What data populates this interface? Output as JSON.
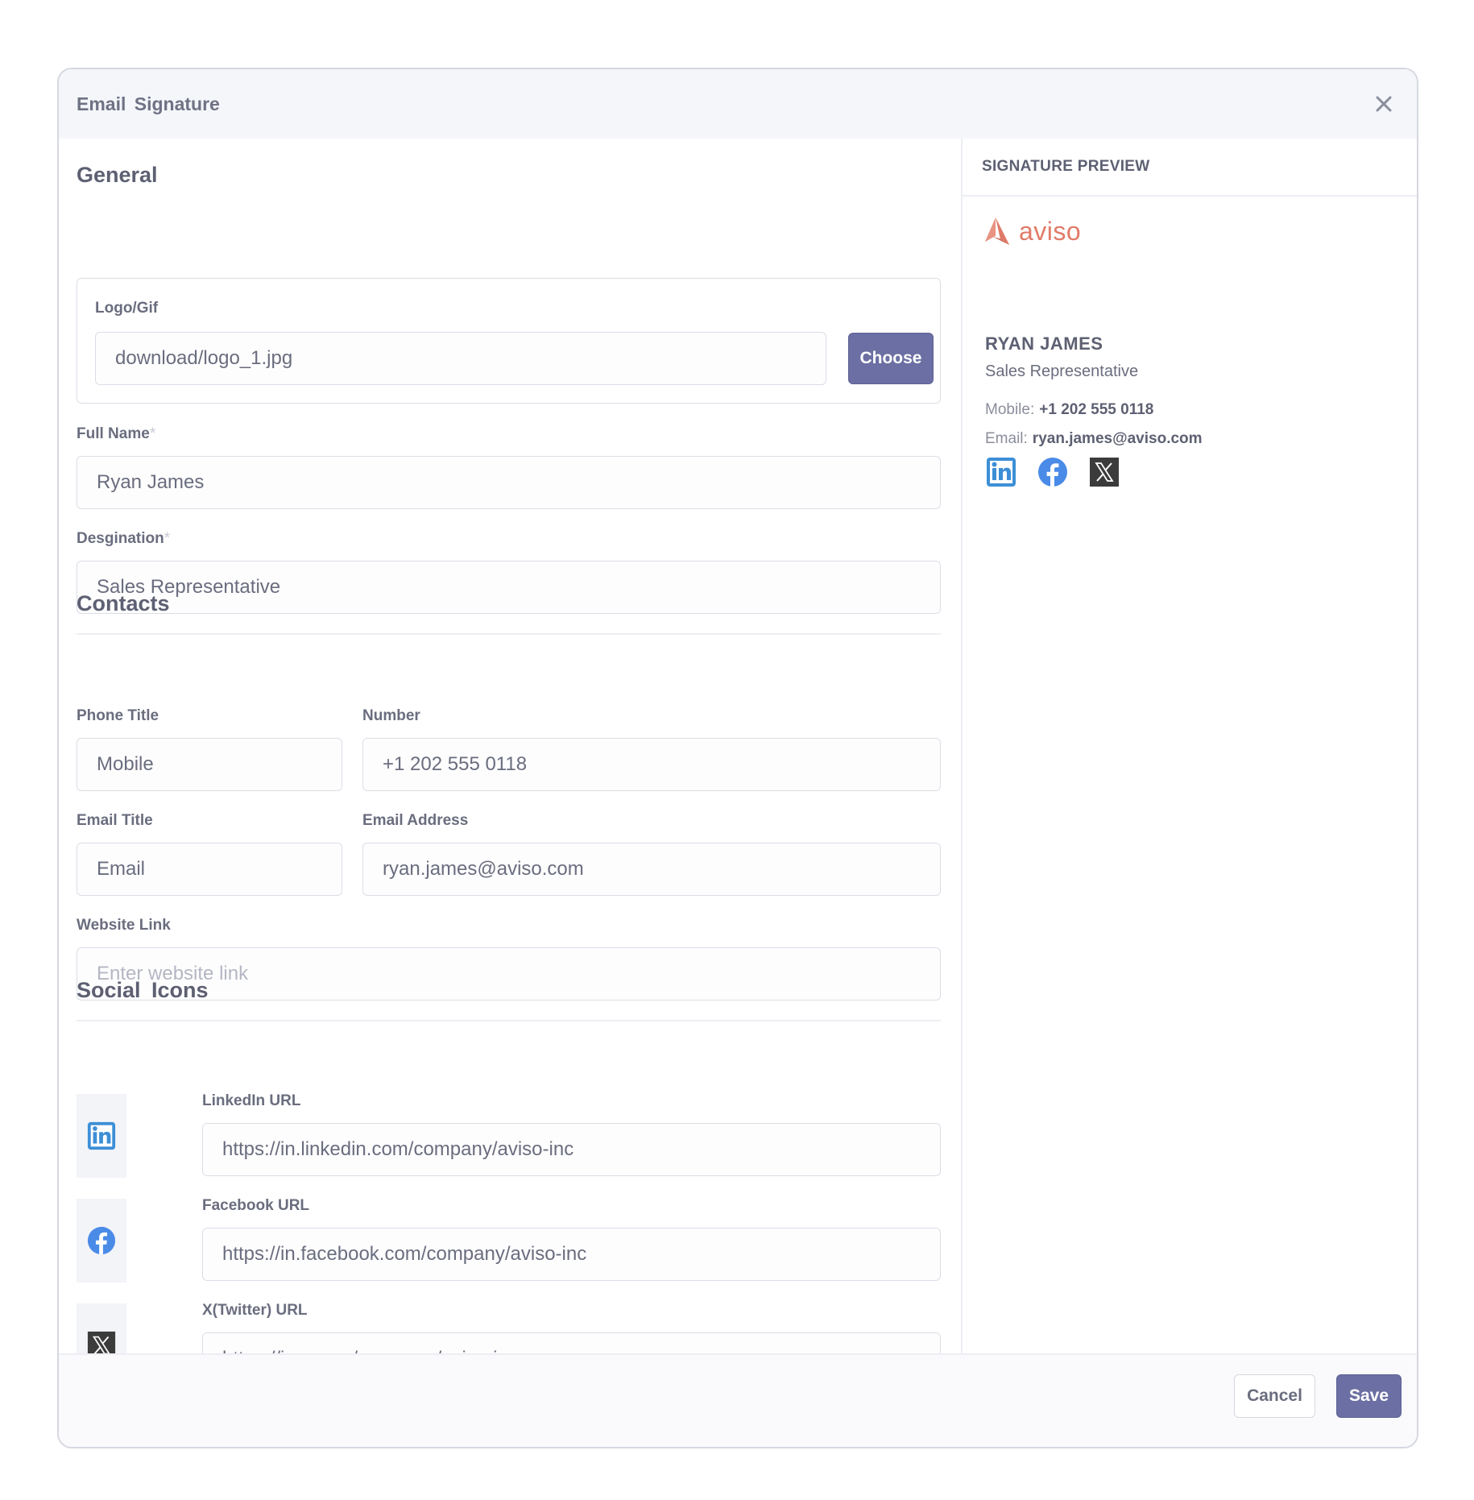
{
  "dialog": {
    "title": "Email  Signature",
    "close_icon": "close-icon"
  },
  "general": {
    "title": "General",
    "logo_label": "Logo/Gif",
    "logo_value": "download/logo_1.jpg",
    "choose_label": "Choose",
    "full_name_label": "Full Name",
    "full_name_value": "Ryan James",
    "designation_label": "Desgination",
    "designation_value": "Sales Representative",
    "required_mark": "*"
  },
  "contacts": {
    "title": "Contacts",
    "phone_title_label": "Phone Title",
    "phone_title_value": "Mobile",
    "number_label": "Number",
    "number_value": "+1 202 555 0118",
    "email_title_label": "Email Title",
    "email_title_value": "Email",
    "email_address_label": "Email Address",
    "email_address_value": "ryan.james@aviso.com",
    "website_label": "Website Link",
    "website_placeholder": "Enter website link"
  },
  "social": {
    "title": "Social  Icons",
    "linkedin_label": "LinkedIn URL",
    "linkedin_value": "https://in.linkedin.com/company/aviso-inc",
    "facebook_label": "Facebook URL",
    "facebook_value": "https://in.facebook.com/company/aviso-inc",
    "x_label": "X(Twitter) URL",
    "x_value": "https://in.x.com/company/aviso-inc"
  },
  "preview": {
    "title": "SIGNATURE PREVIEW",
    "brand_name": "aviso",
    "name": "RYAN JAMES",
    "designation": "Sales Representative",
    "mobile_label": "Mobile:",
    "mobile_value": "+1 202 555 0118",
    "email_label": "Email:",
    "email_value": "ryan.james@aviso.com"
  },
  "footer": {
    "cancel_label": "Cancel",
    "save_label": "Save"
  },
  "colors": {
    "accent": "#6b6fa3",
    "brand": "#e07a68",
    "linkedin": "#3d8fd6",
    "facebook": "#4a8be8",
    "x": "#3b3b3b"
  }
}
